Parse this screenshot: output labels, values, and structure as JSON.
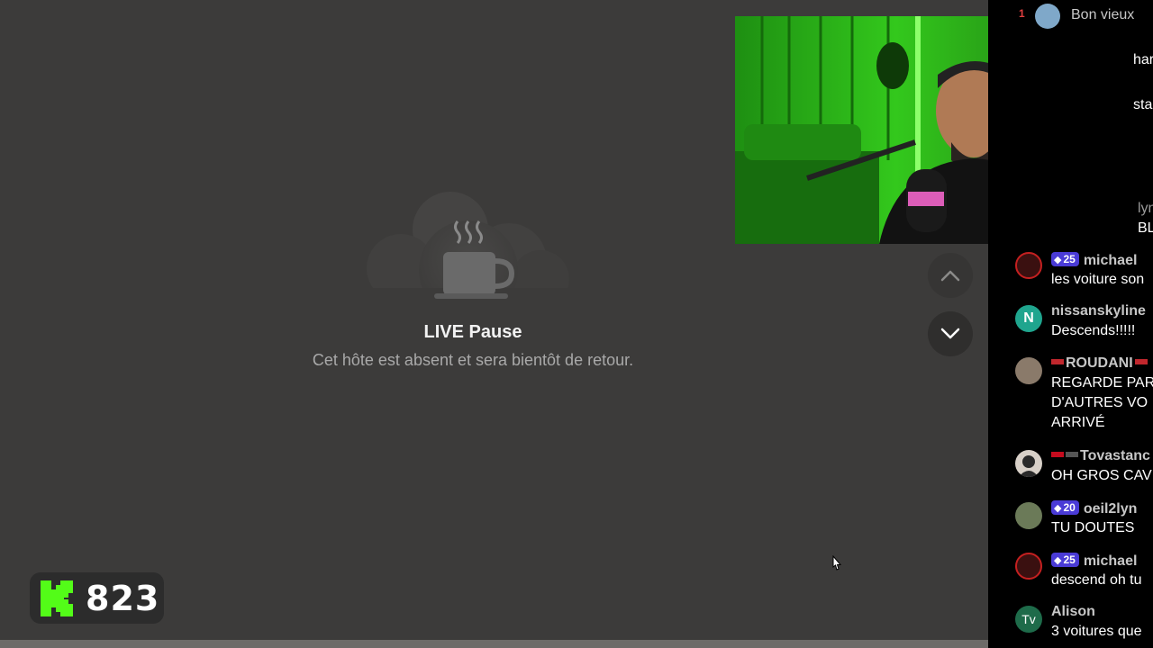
{
  "pause": {
    "title": "LIVE Pause",
    "subtitle": "Cet hôte est absent et sera bientôt de retour."
  },
  "nav": {
    "up_icon": "chevron-up-icon",
    "down_icon": "chevron-down-icon"
  },
  "viewers": {
    "logo": "K",
    "count": "823"
  },
  "webcam": {
    "description_icon": "webcam-feed"
  },
  "chat": {
    "messages": [
      {
        "user": "Bon vieux",
        "badge": "",
        "text": "",
        "avatar": ""
      },
      {
        "user": "",
        "badge": "",
        "text": "har",
        "avatar": ""
      },
      {
        "user": "",
        "badge": "",
        "text": "sta",
        "avatar": ""
      },
      {
        "user": "",
        "badge": "",
        "text": "lyn",
        "avatar": ""
      },
      {
        "user": "",
        "badge": "",
        "text": "BL",
        "avatar": ""
      },
      {
        "user": "michael",
        "badge": "25",
        "text": "les voiture son",
        "avatar": ""
      },
      {
        "user": "nissanskyline",
        "badge": "",
        "text": "Descends!!!!!",
        "avatar": "N"
      },
      {
        "user": "ROUDANI",
        "badge": "",
        "text": "REGARDE PAR",
        "text2": "D'AUTRES VO",
        "text3": "ARRIVÉ",
        "avatar": ""
      },
      {
        "user": "Tovastanc",
        "badge": "",
        "text": "OH GROS CAV",
        "avatar": ""
      },
      {
        "user": "oeil2lyn",
        "badge": "20",
        "text": "TU DOUTES",
        "avatar": ""
      },
      {
        "user": "michael",
        "badge": "25",
        "text": "descend oh tu",
        "avatar": ""
      },
      {
        "user": "Alison",
        "badge": "",
        "text": "3 voitures que",
        "avatar": "Tv"
      }
    ]
  },
  "colors": {
    "accent": "#53fc18",
    "badge": "#4a3bd6",
    "stage": "#3c3b3a"
  }
}
